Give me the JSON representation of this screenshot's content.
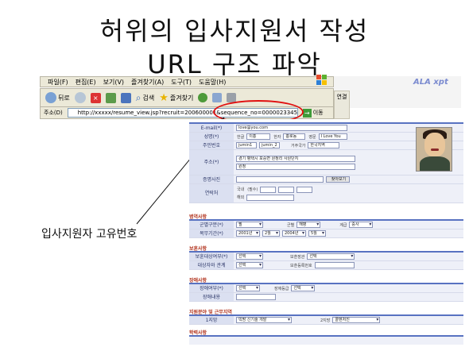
{
  "slide": {
    "title_line1": "허위의 입사지원서 작성",
    "title_line2": "URL 구조 파악",
    "annotation": "입사지원자 고유번호"
  },
  "browser": {
    "menu": [
      "파일(F)",
      "편집(E)",
      "보기(V)",
      "즐겨찾기(A)",
      "도구(T)",
      "도움말(H)"
    ],
    "toolbar": {
      "back": "뒤로",
      "search": "검색",
      "favorites": "즐겨찾기"
    },
    "address_label": "주소(D)",
    "address_url": "http://xxxxx/resume_view.jsp?recruit=200600001&sequence_no=0000023345",
    "go_label": "이동",
    "side_tab": "연결",
    "brand": "ALA xpt"
  },
  "form": {
    "personal": {
      "email_label": "E-mail(*)",
      "email_value": "love@you.com",
      "name_label": "성명(*)",
      "name_hangul_label": "한글",
      "name_hangul": "이홍",
      "name_hanja_label": "한자",
      "name_hanja": "홍로동",
      "name_eng_label": "영문",
      "name_eng": "I Love You",
      "jumin_label": "주민번호",
      "jumin1": "jumin1",
      "jumin2": "jumin_2",
      "nationality_label": "거주국가",
      "nationality": "한국지역",
      "birth_label": "주소(*)",
      "address1": "경기 평택시 포승면 원정리 사원단지",
      "address2": "원정",
      "photo_label": "증명사진",
      "photo_btn": "찾아보기",
      "contact_label": "연락처",
      "phone_label": "국내",
      "phone_hint": "(필수)",
      "overseas_label": "해외"
    },
    "military": {
      "title": "병역사항",
      "type_label": "군별구분(*)",
      "type_value": "필",
      "branch_label": "군별",
      "branch_value": "해병",
      "rank_label": "계급",
      "rank_value": "중사",
      "period_label": "복무기간(*)",
      "period_from_y": "2001년",
      "period_from_m": "2월",
      "period_to_y": "2004년",
      "period_to_m": "5월"
    },
    "veteran": {
      "title": "보훈사항",
      "target_label": "보훈대상여부(*)",
      "target_value": "선택",
      "rel_label": "보훈장관",
      "rel_value": "선택",
      "family_label": "대상자와 관계",
      "family_value": "선택",
      "num_label": "보훈등록번호"
    },
    "disability": {
      "title": "장애사항",
      "target_label": "장애여부(*)",
      "target_value": "선택",
      "grade_label": "장애등급",
      "grade_value": "선택",
      "detail_label": "장애내용"
    },
    "hope": {
      "title": "지원분야 및 근무지역",
      "first_label": "1지망",
      "first_value": "빅팜 신기술 개발",
      "second_label": "2지망",
      "second_value": "콜벤처진"
    },
    "education": {
      "title": "학력사항"
    }
  }
}
